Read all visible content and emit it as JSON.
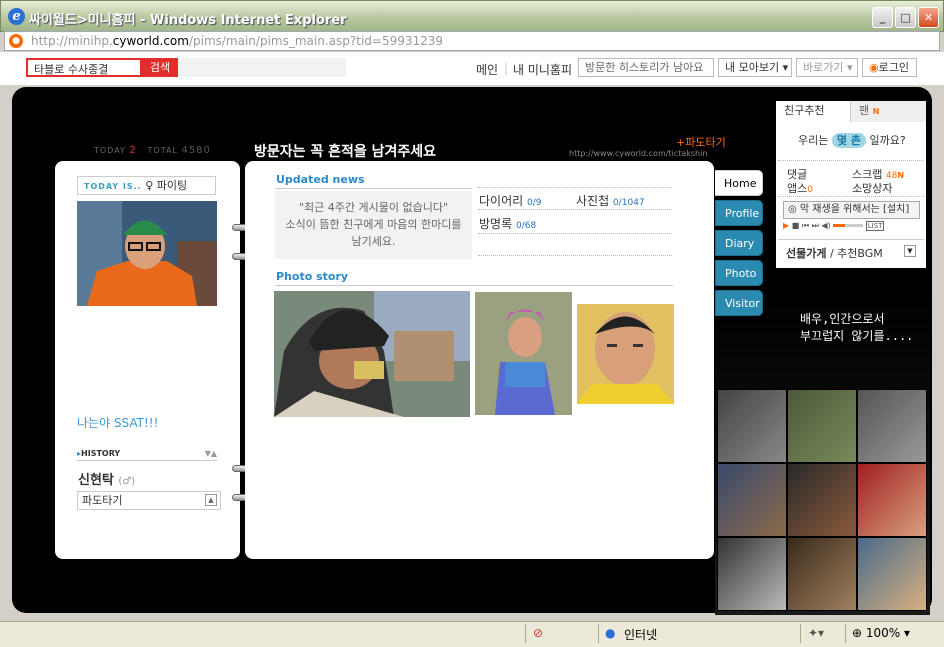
{
  "window": {
    "title": "싸이월드>미니홈피 - Windows Internet Explorer"
  },
  "address": {
    "url_prefix": "http://minihp.",
    "url_domain": "cyworld.com",
    "url_suffix": "/pims/main/pims_main.asp?tid=59931239"
  },
  "toolbar": {
    "search_value": "타블로 수사종결",
    "search_button": "검색",
    "links": [
      "메인",
      "내 미니홈피"
    ],
    "history_box": "방문한 히스토리가 남아요",
    "collect_box": "내 모아보기",
    "shortcut_box": "바로가기",
    "login": "로그인"
  },
  "minihp": {
    "today_label": "TODAY",
    "today_count": "2",
    "total_label": "TOTAL",
    "total_count": "4580",
    "title": "방문자는 꼭 흔적을 남겨주세요",
    "pado": "파도타기",
    "url": "http://www.cyworld.com/tictakshin"
  },
  "left": {
    "today_is_label": "TODAY IS..",
    "mood": "파이팅",
    "bio": "나는야 SSAT!!!",
    "history_label": "HISTORY",
    "owner_name": "신현탁",
    "owner_gender": "(♂)",
    "pado_select": "파도타기"
  },
  "main": {
    "updated_title": "Updated news",
    "news_line1": "\"최근 4주간 게시물이 없습니다\"",
    "news_line2": "소식이 뜸한 친구에게 마음의 한마디를",
    "news_line3": "남기세요.",
    "diary_label": "다이어리",
    "diary_count": "0/9",
    "album_label": "사진첩",
    "album_count": "0/1047",
    "guestbook_label": "방명록",
    "guestbook_count": "0/68",
    "photo_title": "Photo story"
  },
  "tabs": [
    "Home",
    "Profile",
    "Diary",
    "Photo",
    "Visitor"
  ],
  "right": {
    "tab_friends": "친구추천",
    "tab_fans": "팬",
    "question_pre": "우리는",
    "question_hl": "몇 촌",
    "question_post": "일까요?",
    "comments": "댓글",
    "scrap": "스크랩",
    "scrap_count": "48",
    "apps": "앱스",
    "apps_count": "0",
    "wishlist": "소망상자",
    "player_text": "악 재생을 위해서는 [설치]",
    "shop": "선물가게",
    "bgm": "/ 추천BGM",
    "list": "LIST"
  },
  "slogan": {
    "line1": "배우,인간으로서",
    "line2": "부끄럽지 않기를...."
  },
  "status": {
    "zone": "인터넷",
    "zoom": "100%"
  },
  "colors": {
    "accent": "#2a8ac6",
    "cyworld_orange": "#ff6a00",
    "search_red": "#e32d2d"
  }
}
